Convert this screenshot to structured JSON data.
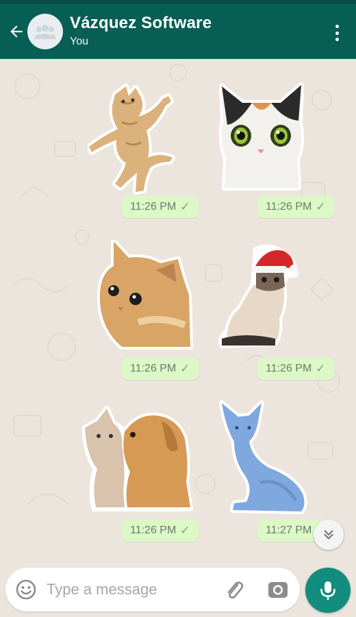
{
  "header": {
    "title": "Vázquez Software",
    "subtitle": "You",
    "back_icon": "arrow-left-icon",
    "avatar_icon": "group-icon",
    "menu_icon": "more-vertical-icon"
  },
  "messages": [
    {
      "sticker": "dancing-cat-sticker",
      "time": "11:26 PM",
      "status": "read-check-icon"
    },
    {
      "sticker": "big-eyed-kitten-sticker",
      "time": "11:26 PM",
      "status": "read-check-icon"
    },
    {
      "sticker": "orange-cat-peeking-sticker",
      "time": "11:26 PM",
      "status": "read-check-icon"
    },
    {
      "sticker": "santa-hat-cat-sticker",
      "time": "11:26 PM",
      "status": "read-check-icon"
    },
    {
      "sticker": "kitten-and-puppy-sticker",
      "time": "11:26 PM",
      "status": "read-check-icon"
    },
    {
      "sticker": "blue-sphynx-cat-sticker",
      "time": "11:27 PM",
      "status": "read-check-icon"
    }
  ],
  "composer": {
    "placeholder": "Type a message",
    "emoji_icon": "emoji-icon",
    "attach_icon": "paperclip-icon",
    "camera_icon": "camera-icon",
    "mic_icon": "microphone-icon"
  },
  "scroll_down_icon": "double-chevron-down-icon",
  "colors": {
    "header": "#075e54",
    "status_bar": "#054d44",
    "chat_background": "#ece5dd",
    "bubble": "#dcf8c6",
    "mic_button": "#128c7e"
  }
}
